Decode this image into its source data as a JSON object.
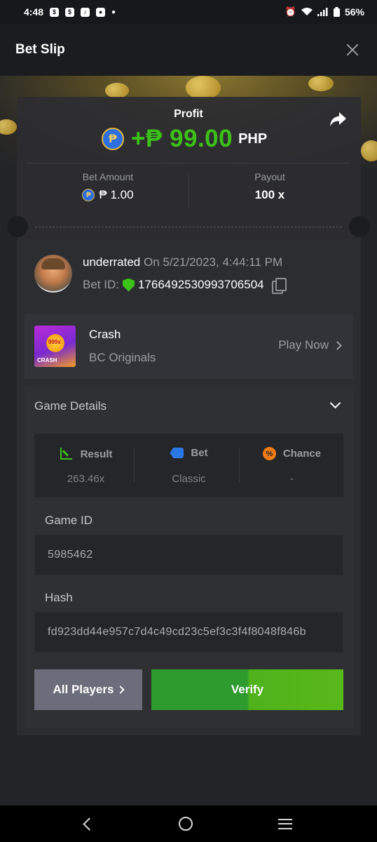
{
  "status_bar": {
    "time": "4:48",
    "battery": "56%"
  },
  "header": {
    "title": "Bet Slip"
  },
  "profit": {
    "label": "Profit",
    "currency_symbol": "₱",
    "amount": "+₱ 99.00",
    "currency": "PHP"
  },
  "bet_amount": {
    "label": "Bet Amount",
    "value": "₱ 1.00"
  },
  "payout": {
    "label": "Payout",
    "value": "100 x"
  },
  "user": {
    "name": "underrated",
    "on_text": "On 5/21/2023, 4:44:11 PM",
    "bet_id_label": "Bet ID:",
    "bet_id": "1766492530993706504"
  },
  "game": {
    "name": "Crash",
    "provider": "BC Originals",
    "play_now": "Play Now",
    "thumb_badge": "999x",
    "thumb_label": "CRASH"
  },
  "details": {
    "title": "Game Details",
    "stats": [
      {
        "label": "Result",
        "value": "263.46x",
        "icon": "chart-up-icon",
        "color": "#3bc117"
      },
      {
        "label": "Bet",
        "value": "Classic",
        "icon": "tag-icon",
        "color": "#2a78e8"
      },
      {
        "label": "Chance",
        "value": "-",
        "icon": "percent-icon",
        "color": "#ef7b14"
      }
    ],
    "game_id_label": "Game ID",
    "game_id": "5985462",
    "hash_label": "Hash",
    "hash": "fd923dd44e957c7d4c49cd23c5ef3c3f4f8048f846b"
  },
  "buttons": {
    "all_players": "All Players",
    "verify": "Verify"
  },
  "colors": {
    "profit_green": "#3bc117",
    "verify_green": "#2e9b2e",
    "background": "#232427"
  }
}
